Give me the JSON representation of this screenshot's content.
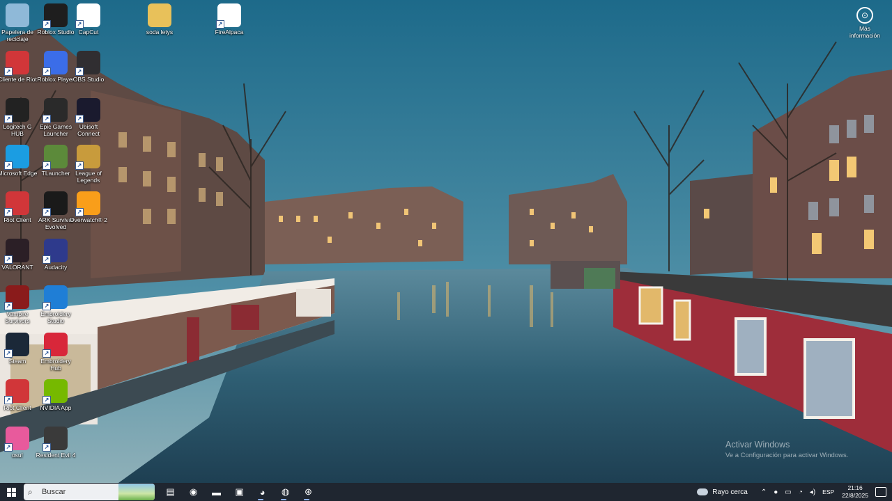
{
  "desktop": {
    "icons": [
      {
        "label": "Papelera de reciclaje",
        "icon": "recycle-bin-icon",
        "color": "#8fb9d8"
      },
      {
        "label": "Roblox Studio",
        "icon": "roblox-studio-icon",
        "color": "#1e1e1e"
      },
      {
        "label": "CapCut",
        "icon": "capcut-icon",
        "color": "#ffffff"
      },
      {
        "label": "soda letys",
        "icon": "folder-icon",
        "color": "#e8c15a"
      },
      {
        "label": "FireAlpaca",
        "icon": "firealpaca-icon",
        "color": "#ffffff"
      },
      {
        "label": "Cliente de Riot",
        "icon": "riot-client-icon",
        "color": "#d13639"
      },
      {
        "label": "Roblox Player",
        "icon": "roblox-player-icon",
        "color": "#3b6de8"
      },
      {
        "label": "OBS Studio",
        "icon": "obs-studio-icon",
        "color": "#302e31"
      },
      {
        "label": "Logitech G HUB",
        "icon": "logitech-ghub-icon",
        "color": "#222222"
      },
      {
        "label": "Epic Games Launcher",
        "icon": "epic-games-icon",
        "color": "#2a2a2a"
      },
      {
        "label": "Ubisoft Connect",
        "icon": "ubisoft-connect-icon",
        "color": "#1a1a2e"
      },
      {
        "label": "Microsoft Edge",
        "icon": "edge-icon",
        "color": "#1b9de2"
      },
      {
        "label": "TLauncher",
        "icon": "tlauncher-icon",
        "color": "#5c8a3a"
      },
      {
        "label": "League of Legends",
        "icon": "league-of-legends-icon",
        "color": "#c89b3c"
      },
      {
        "label": "Riot Client",
        "icon": "riot-client-icon",
        "color": "#d13639"
      },
      {
        "label": "ARK Survival Evolved",
        "icon": "ark-icon",
        "color": "#1a1a1a"
      },
      {
        "label": "Overwatch® 2",
        "icon": "overwatch-icon",
        "color": "#f99e1a"
      },
      {
        "label": "VALORANT",
        "icon": "valorant-icon",
        "color": "#2b1f26"
      },
      {
        "label": "Audacity",
        "icon": "audacity-icon",
        "color": "#2e3a8c"
      },
      {
        "label": "Vampire Survivors",
        "icon": "vampire-survivors-icon",
        "color": "#8a1b1b"
      },
      {
        "label": "Embroidery Studio",
        "icon": "embroidery-studio-icon",
        "color": "#1f7ed6"
      },
      {
        "label": "Steam",
        "icon": "steam-icon",
        "color": "#1b2838"
      },
      {
        "label": "Embroidery Hub",
        "icon": "embroidery-hub-icon",
        "color": "#d8273a"
      },
      {
        "label": "Riot Client",
        "icon": "riot-client-icon",
        "color": "#d13639"
      },
      {
        "label": "NVIDIA App",
        "icon": "nvidia-icon",
        "color": "#76b900"
      },
      {
        "label": "osu!",
        "icon": "osu-icon",
        "color": "#e85a9c"
      },
      {
        "label": "Resident Evil 4",
        "icon": "resident-evil-icon",
        "color": "#3a3a3a"
      }
    ],
    "more_info_label": "Más información",
    "watermark": {
      "title": "Activar Windows",
      "subtitle": "Ve a Configuración para activar Windows."
    }
  },
  "taskbar": {
    "search_placeholder": "Buscar",
    "apps": [
      {
        "icon": "task-view-icon",
        "glyph": "▤"
      },
      {
        "icon": "edge-icon",
        "glyph": "◉"
      },
      {
        "icon": "file-explorer-icon",
        "glyph": "▬"
      },
      {
        "icon": "microsoft-store-icon",
        "glyph": "▣"
      },
      {
        "icon": "discord-icon",
        "glyph": "◕"
      },
      {
        "icon": "obs-studio-icon",
        "glyph": "◍"
      },
      {
        "icon": "overwatch-icon",
        "glyph": "⊛"
      }
    ],
    "weather": "Rayo cerca",
    "language": "ESP",
    "time": "21:16",
    "date": "22/8/2025"
  }
}
